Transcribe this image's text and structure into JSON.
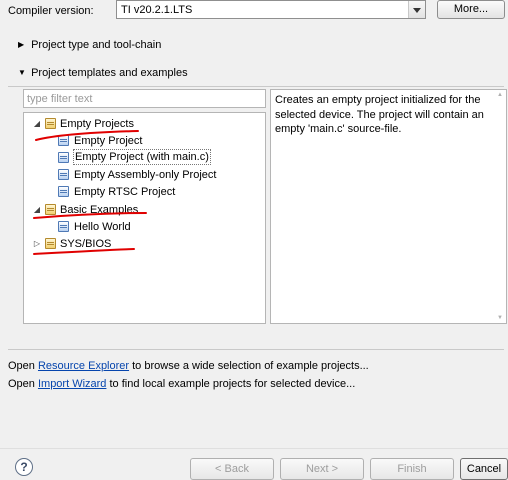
{
  "compiler": {
    "label": "Compiler version:",
    "value": "TI v20.2.1.LTS",
    "more_label": "More..."
  },
  "sections": [
    {
      "label": "Project type and tool-chain",
      "expanded": false
    },
    {
      "label": "Project templates and examples",
      "expanded": true
    }
  ],
  "filter": {
    "placeholder": "type filter text",
    "value": ""
  },
  "tree": [
    {
      "label": "Empty Projects",
      "kind": "folder",
      "expanded": true,
      "children": [
        {
          "label": "Empty Project",
          "kind": "project"
        },
        {
          "label": "Empty Project (with main.c)",
          "kind": "project",
          "selected": true
        },
        {
          "label": "Empty Assembly-only Project",
          "kind": "project"
        },
        {
          "label": "Empty RTSC Project",
          "kind": "project"
        }
      ]
    },
    {
      "label": "Basic Examples",
      "kind": "folder",
      "expanded": true,
      "children": [
        {
          "label": "Hello World",
          "kind": "project"
        }
      ]
    },
    {
      "label": "SYS/BIOS",
      "kind": "folder",
      "expanded": false
    }
  ],
  "description": "Creates an empty project initialized for the selected device. The project will contain an empty 'main.c' source-file.",
  "info_lines": [
    {
      "prefix": "Open ",
      "link": "Resource Explorer",
      "suffix": " to browse a wide selection of example projects..."
    },
    {
      "prefix": "Open ",
      "link": "Import Wizard",
      "suffix": " to find local example projects for selected device..."
    }
  ],
  "buttons": {
    "help": "?",
    "back": "< Back",
    "next": "Next >",
    "finish": "Finish",
    "cancel": "Cancel"
  },
  "annotation_color": "#e00000"
}
